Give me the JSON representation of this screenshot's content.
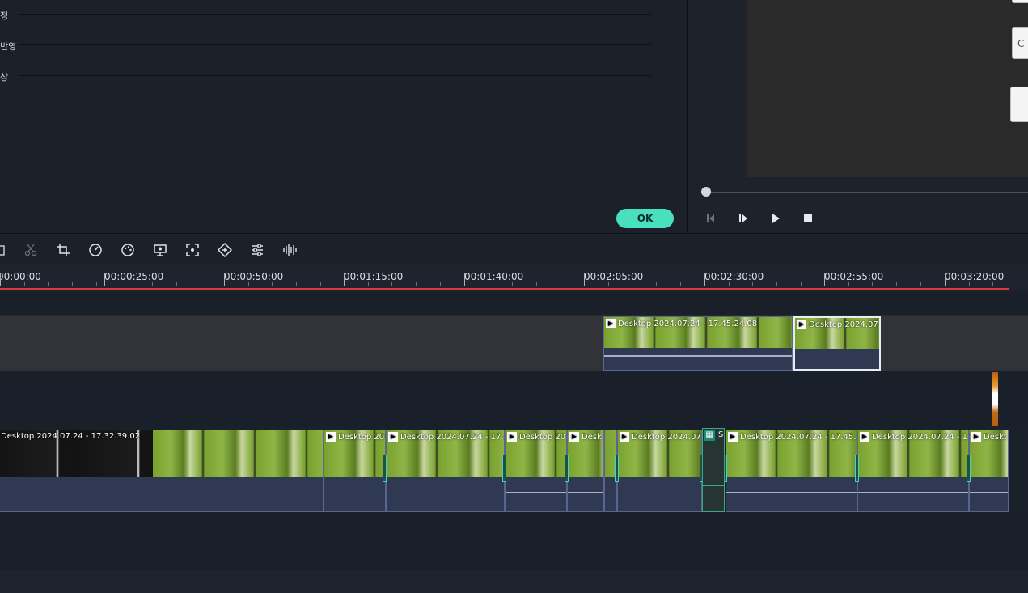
{
  "properties": {
    "rows": [
      {
        "label": "정"
      },
      {
        "label": "반영"
      },
      {
        "label": "상"
      }
    ],
    "ok_label": "OK"
  },
  "preview": {
    "side_button_label": "C",
    "controls": [
      "step-back-icon",
      "play-frame-icon",
      "play-icon",
      "stop-icon"
    ],
    "progress": 0
  },
  "toolbar": {
    "tools": [
      "delete-icon",
      "scissors-icon",
      "crop-icon",
      "speed-icon",
      "color-palette-icon",
      "screen-record-icon",
      "auto-reframe-icon",
      "keyframe-icon",
      "adjust-icon",
      "audio-wave-icon"
    ]
  },
  "ruler": {
    "ticks": [
      "00:00:00",
      "00:00:25:00",
      "00:00:50:00",
      "00:01:15:00",
      "00:01:40:00",
      "00:02:05:00",
      "00:02:30:00",
      "00:02:55:00",
      "00:03:20:00"
    ]
  },
  "timeline": {
    "track2_clips": [
      {
        "name": "Desktop 2024.07.24 - 17.45.24.08"
      },
      {
        "name": "Desktop 2024.07"
      }
    ],
    "track1_clips": [
      {
        "name": "Desktop 2024.07.24 - 17.32.39.02"
      },
      {
        "name": "Desktop 20"
      },
      {
        "name": "Desktop 2024.07.24 - 17.4"
      },
      {
        "name": "Desktop 20"
      },
      {
        "name": "Desk"
      },
      {
        "name": ""
      },
      {
        "name": "Desktop 2024.07."
      },
      {
        "name": "Desktop 2024.07.24 - 17.45.2"
      },
      {
        "name": "Desktop 2024.07.24 - 1"
      },
      {
        "name": "Deskt"
      }
    ],
    "text_clip_label": "S"
  },
  "colors": {
    "accent": "#49e0c0",
    "playhead": "#d93a3a",
    "clip_border": "#5a6590"
  }
}
